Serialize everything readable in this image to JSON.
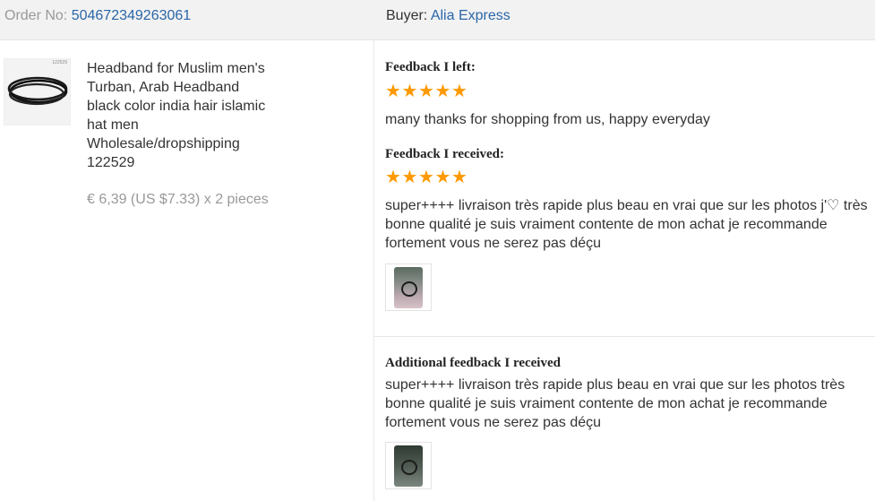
{
  "header": {
    "order_label": "Order No:",
    "order_number": "504672349263061",
    "buyer_label": "Buyer:",
    "buyer_name": "Alia Express"
  },
  "product": {
    "thumb_code": "122529",
    "title": "Headband for Muslim men's Turban, Arab Headband black color india hair islamic hat men Wholesale/dropshipping 122529",
    "price": "€ 6,39 (US $7.33) x 2 pieces"
  },
  "feedback_left": {
    "heading": "Feedback I left:",
    "rating": 5,
    "text": "many thanks for shopping from us, happy everyday"
  },
  "feedback_received": {
    "heading": "Feedback I received:",
    "rating": 5,
    "text": "super++++ livraison très rapide plus beau en vrai que sur les photos j'♡ très bonne qualité je suis vraiment contente de mon achat je recommande fortement vous ne serez pas déçu"
  },
  "additional_feedback": {
    "heading": "Additional feedback I received",
    "text": "super++++ livraison très rapide plus beau en vrai que sur les photos très bonne qualité je suis vraiment contente de mon achat je recommande fortement vous ne serez pas déçu"
  },
  "colors": {
    "link": "#2966a8",
    "star": "#ff9900",
    "header_bg": "#f2f2f2",
    "muted_text": "#999999"
  }
}
